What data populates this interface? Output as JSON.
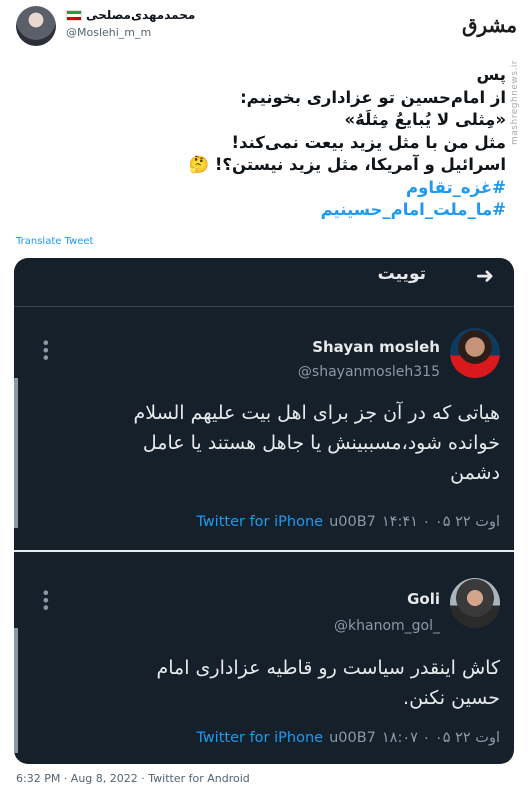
{
  "header": {
    "display_name": "محمدمهدی‌مصلحی",
    "handle": "@Moslehi_m_m",
    "logo_text": "مشرق",
    "watermark": "mashreghnews.ir"
  },
  "tweet": {
    "lines": [
      "پس",
      "از امام‌حسین تو عزاداری بخونیم:",
      "«مِثلی لا یُبایعُ مِثلَهُ»",
      "مثل من با مثل یزید بیعت نمی‌کند!",
      "اسرائیل و آمریکا، مثل یزید نیستن؟! 🤔"
    ],
    "hashtags": [
      "#غزه_تقاوم",
      "#ما_ملت_امام_حسینیم"
    ],
    "translate_label": "Translate Tweet"
  },
  "card": {
    "title": "توییت",
    "back_icon": "arrow-right-icon",
    "tweets": [
      {
        "name": "Shayan mosleh",
        "handle": "@shayanmosleh315",
        "text": [
          "هیاتی که در آن جز برای اهل بیت علیهم السلام",
          "خوانده شود،مسببینش یا جاهل هستند یا عامل",
          "دشمن"
        ],
        "time": "۱۴:۴۱ ۰ ۰۵ اوت ۲۲",
        "source_sep": "u00B7",
        "source": "Twitter for iPhone"
      },
      {
        "name": "Goli",
        "handle": "@khanom_gol_",
        "text": [
          "کاش اینقدر سیاست رو قاطیه عزاداری امام",
          "حسین نکنن."
        ],
        "time": "۱۸:۰۷ ۰ ۰۵ اوت ۲۲",
        "source_sep": "u00B7",
        "source": "Twitter for iPhone"
      }
    ]
  },
  "footer": {
    "meta": "6:32 PM · Aug 8, 2022 · Twitter for Android"
  }
}
